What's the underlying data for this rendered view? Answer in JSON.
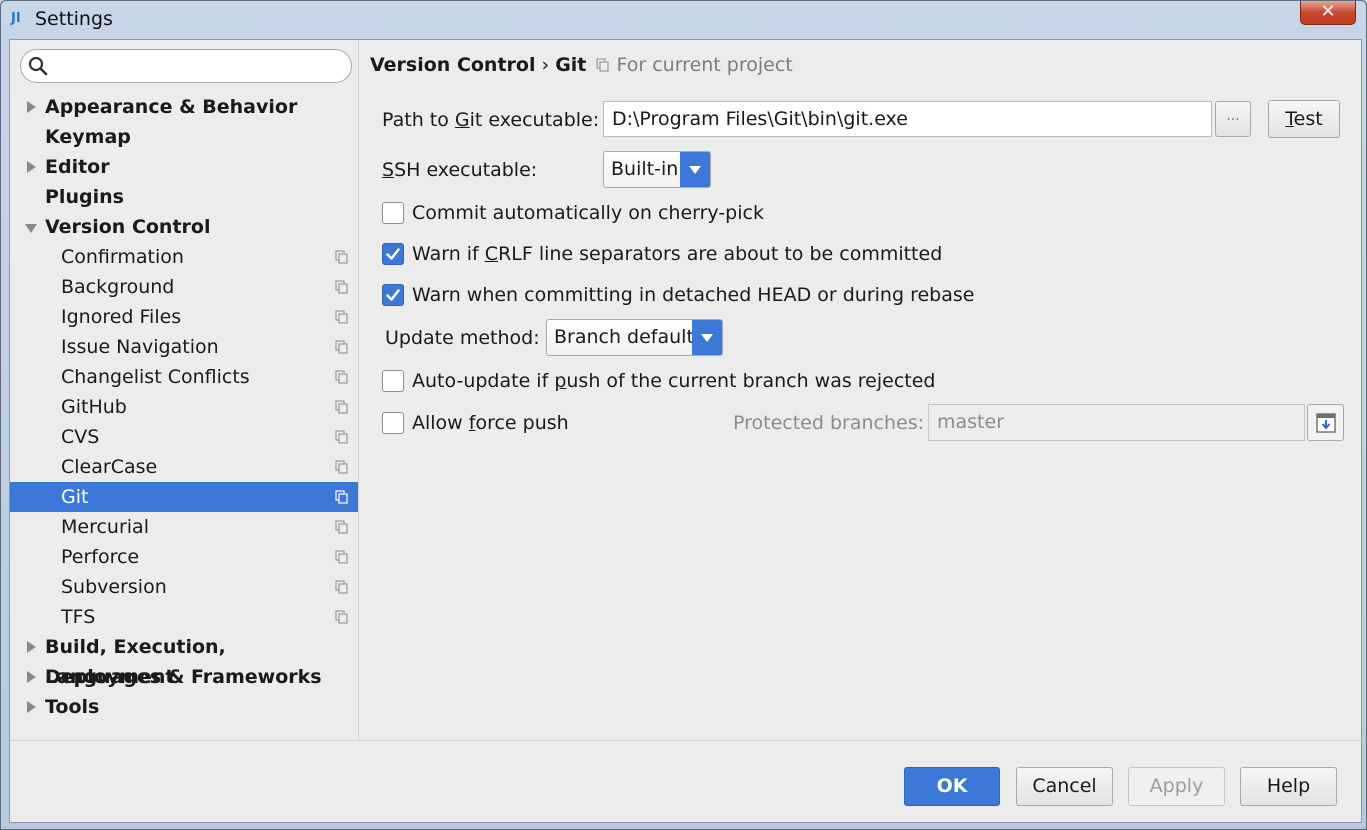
{
  "window": {
    "title": "Settings",
    "close_symbol": "✕"
  },
  "search": {
    "placeholder": "",
    "value": ""
  },
  "tree": {
    "items": [
      {
        "label": "Appearance & Behavior",
        "level": 0,
        "expandable": true,
        "expanded": false
      },
      {
        "label": "Keymap",
        "level": 0,
        "expandable": false
      },
      {
        "label": "Editor",
        "level": 0,
        "expandable": true,
        "expanded": false
      },
      {
        "label": "Plugins",
        "level": 0,
        "expandable": false
      },
      {
        "label": "Version Control",
        "level": 0,
        "expandable": true,
        "expanded": true
      },
      {
        "label": "Confirmation",
        "level": 1,
        "project_icon": true
      },
      {
        "label": "Background",
        "level": 1,
        "project_icon": true
      },
      {
        "label": "Ignored Files",
        "level": 1,
        "project_icon": true
      },
      {
        "label": "Issue Navigation",
        "level": 1,
        "project_icon": true
      },
      {
        "label": "Changelist Conflicts",
        "level": 1,
        "project_icon": true
      },
      {
        "label": "GitHub",
        "level": 1,
        "project_icon": true
      },
      {
        "label": "CVS",
        "level": 1,
        "project_icon": true
      },
      {
        "label": "ClearCase",
        "level": 1,
        "project_icon": true
      },
      {
        "label": "Git",
        "level": 1,
        "project_icon": true,
        "selected": true
      },
      {
        "label": "Mercurial",
        "level": 1,
        "project_icon": true
      },
      {
        "label": "Perforce",
        "level": 1,
        "project_icon": true
      },
      {
        "label": "Subversion",
        "level": 1,
        "project_icon": true
      },
      {
        "label": "TFS",
        "level": 1,
        "project_icon": true
      },
      {
        "label": "Build, Execution, Deployment",
        "level": 0,
        "expandable": true,
        "expanded": false
      },
      {
        "label": "Languages & Frameworks",
        "level": 0,
        "expandable": true,
        "expanded": false
      },
      {
        "label": "Tools",
        "level": 0,
        "expandable": true,
        "expanded": false
      }
    ]
  },
  "breadcrumb": {
    "parent": "Version Control",
    "separator": "›",
    "current": "Git",
    "note": "For current project"
  },
  "git": {
    "path_label_pre": "Path to ",
    "path_label_mn": "G",
    "path_label_post": "it executable:",
    "path_value": "D:\\Program Files\\Git\\bin\\git.exe",
    "browse_label": "...",
    "test_label_mn": "T",
    "test_label_rest": "est",
    "ssh_label_mn": "S",
    "ssh_label_rest": "SH executable:",
    "ssh_value": "Built-in",
    "commit_cherry_pick_label": "Commit automatically on cherry-pick",
    "commit_cherry_pick_checked": false,
    "warn_crlf_pre": "Warn if ",
    "warn_crlf_mn": "C",
    "warn_crlf_post": "RLF line separators are about to be committed",
    "warn_crlf_checked": true,
    "warn_detached_label": "Warn when committing in detached HEAD or during rebase",
    "warn_detached_checked": true,
    "update_method_label": "Update method:",
    "update_method_value": "Branch default",
    "auto_update_pre": "Auto-update if ",
    "auto_update_mn": "p",
    "auto_update_post": "ush of the current branch was rejected",
    "auto_update_checked": false,
    "force_push_pre": "Allow ",
    "force_push_mn": "f",
    "force_push_post": "orce push",
    "force_push_checked": false,
    "protected_label": "Protected branches:",
    "protected_value": "master"
  },
  "buttons": {
    "ok": "OK",
    "cancel": "Cancel",
    "apply": "Apply",
    "help": "Help"
  },
  "colors": {
    "accent": "#3c78d8",
    "selection": "#3c78d8",
    "background": "#ececec"
  }
}
